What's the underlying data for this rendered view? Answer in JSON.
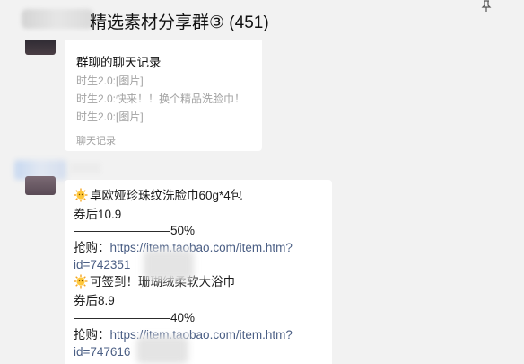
{
  "header": {
    "title": "精选素材分享群③ (451)"
  },
  "chat_record_card": {
    "title": "群聊的聊天记录",
    "lines": [
      "时生2.0:[图片]",
      "时生2.0:快来！！换个精品洗脸巾！",
      "时生2.0:[图片]"
    ],
    "footer": "聊天记录"
  },
  "message": {
    "item1": {
      "name": "卓欧娅珍珠纹洗脸巾60g*4包",
      "price": "券后10.9",
      "discount": "————————50%",
      "buy_label": "抢购：",
      "link_line1": "https://item.taobao.com/item.htm?",
      "link_line2": "id=742351"
    },
    "item2": {
      "name": "可签到！珊瑚绒柔软大浴巾",
      "price": "券后8.9",
      "discount": "————————40%",
      "buy_label": "抢购：",
      "link_line1": "https://item.taobao.com/item.htm?",
      "link_line2": "id=747616"
    }
  },
  "icons": {
    "pin": "pin-icon",
    "sun": "sun-emoji-icon"
  },
  "colors": {
    "link": "#4a5e84",
    "background": "#f2f2f2",
    "muted": "#a3a3a3"
  }
}
